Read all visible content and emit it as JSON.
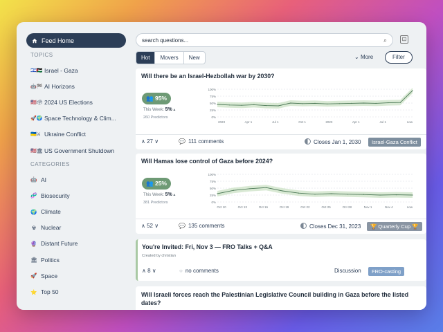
{
  "sidebar": {
    "feed_home": "Feed Home",
    "topics_title": "TOPICS",
    "topics": [
      {
        "icon": "🇮🇱🇵🇸",
        "label": "Israel - Gaza"
      },
      {
        "icon": "🤖🏁",
        "label": "AI Horizons"
      },
      {
        "icon": "🇺🇸🗳",
        "label": "2024 US Elections"
      },
      {
        "icon": "🚀🌍",
        "label": "Space Technology & Clim..."
      },
      {
        "icon": "🇺🇦⚔",
        "label": "Ukraine Conflict"
      },
      {
        "icon": "🇺🇸🏛",
        "label": "US Government Shutdown"
      }
    ],
    "categories_title": "CATEGORIES",
    "categories": [
      {
        "icon": "🤖",
        "label": "AI"
      },
      {
        "icon": "🧬",
        "label": "Biosecurity"
      },
      {
        "icon": "🌍",
        "label": "Climate"
      },
      {
        "icon": "☢",
        "label": "Nuclear"
      },
      {
        "icon": "🔮",
        "label": "Distant Future"
      },
      {
        "icon": "🏛",
        "label": "Politics"
      },
      {
        "icon": "🚀",
        "label": "Space"
      },
      {
        "icon": "⭐",
        "label": "Top 50"
      }
    ]
  },
  "search": {
    "value": "search questions..."
  },
  "tabs": [
    "Hot",
    "Movers",
    "New"
  ],
  "more_label": "More",
  "filter_label": "Filter",
  "cards": [
    {
      "title": "Will there be an Israel-Hezbollah war by 2030?",
      "pct": "95%",
      "week_label": "This Week:",
      "week_value": "5%",
      "forecasters": "260 Predictors",
      "x_ticks": [
        "2023",
        "Apr 1",
        "Jul 1",
        "Oct 1",
        "2023",
        "Apr 1",
        "Jul 1",
        "now"
      ],
      "y_ticks": [
        "100%",
        "75%",
        "50%",
        "25%",
        "0%"
      ],
      "votes": "27",
      "comments": "111 comments",
      "closes": "Closes Jan 1, 2030",
      "tag": "Israel-Gaza Conflict"
    },
    {
      "title": "Will Hamas lose control of Gaza before 2024?",
      "pct": "25%",
      "week_label": "This Week:",
      "week_value": "5%",
      "forecasters": "381 Predictors",
      "x_ticks": [
        "Oct 10",
        "Oct 13",
        "Oct 16",
        "Oct 19",
        "Oct 22",
        "Oct 25",
        "Oct 28",
        "Nov 1",
        "Nov 4",
        "now"
      ],
      "y_ticks": [
        "100%",
        "75%",
        "50%",
        "25%",
        "0%"
      ],
      "votes": "52",
      "comments": "135 comments",
      "closes": "Closes Dec 31, 2023",
      "tag": "🏆 Quarterly Cup 🏆"
    },
    {
      "title": "You're Invited: Fri, Nov 3 — FRO Talks + Q&A",
      "subtitle": "Created by christian",
      "votes": "8",
      "comments": "no comments",
      "type": "Discussion",
      "tag": "FRO-casting"
    },
    {
      "title": "Will Israeli forces reach the Palestinian Legislative Council building in Gaza before the listed dates?"
    }
  ],
  "chart_data": [
    {
      "type": "area",
      "title": "",
      "x": [
        "2023",
        "Apr 1",
        "Jul 1",
        "Oct 1",
        "2023",
        "Apr 1",
        "Jul 1",
        "now"
      ],
      "ylim": [
        0,
        100
      ],
      "series": [
        {
          "values": [
            45,
            43,
            42,
            44,
            41,
            40,
            50,
            48,
            49,
            47,
            48,
            49,
            50,
            49,
            51,
            52,
            95
          ]
        }
      ]
    },
    {
      "type": "area",
      "title": "",
      "x": [
        "Oct 10",
        "Oct 13",
        "Oct 16",
        "Oct 19",
        "Oct 22",
        "Oct 25",
        "Oct 28",
        "Nov 1",
        "Nov 4",
        "now"
      ],
      "ylim": [
        0,
        100
      ],
      "series": [
        {
          "values": [
            30,
            42,
            48,
            52,
            40,
            32,
            28,
            30,
            28,
            27,
            25,
            26,
            25
          ]
        }
      ]
    }
  ],
  "colors": {
    "accent": "#2c3e57",
    "green": "#6e9a75",
    "tag": "#7d8e9e",
    "tag_blue": "#7fa0c8"
  }
}
